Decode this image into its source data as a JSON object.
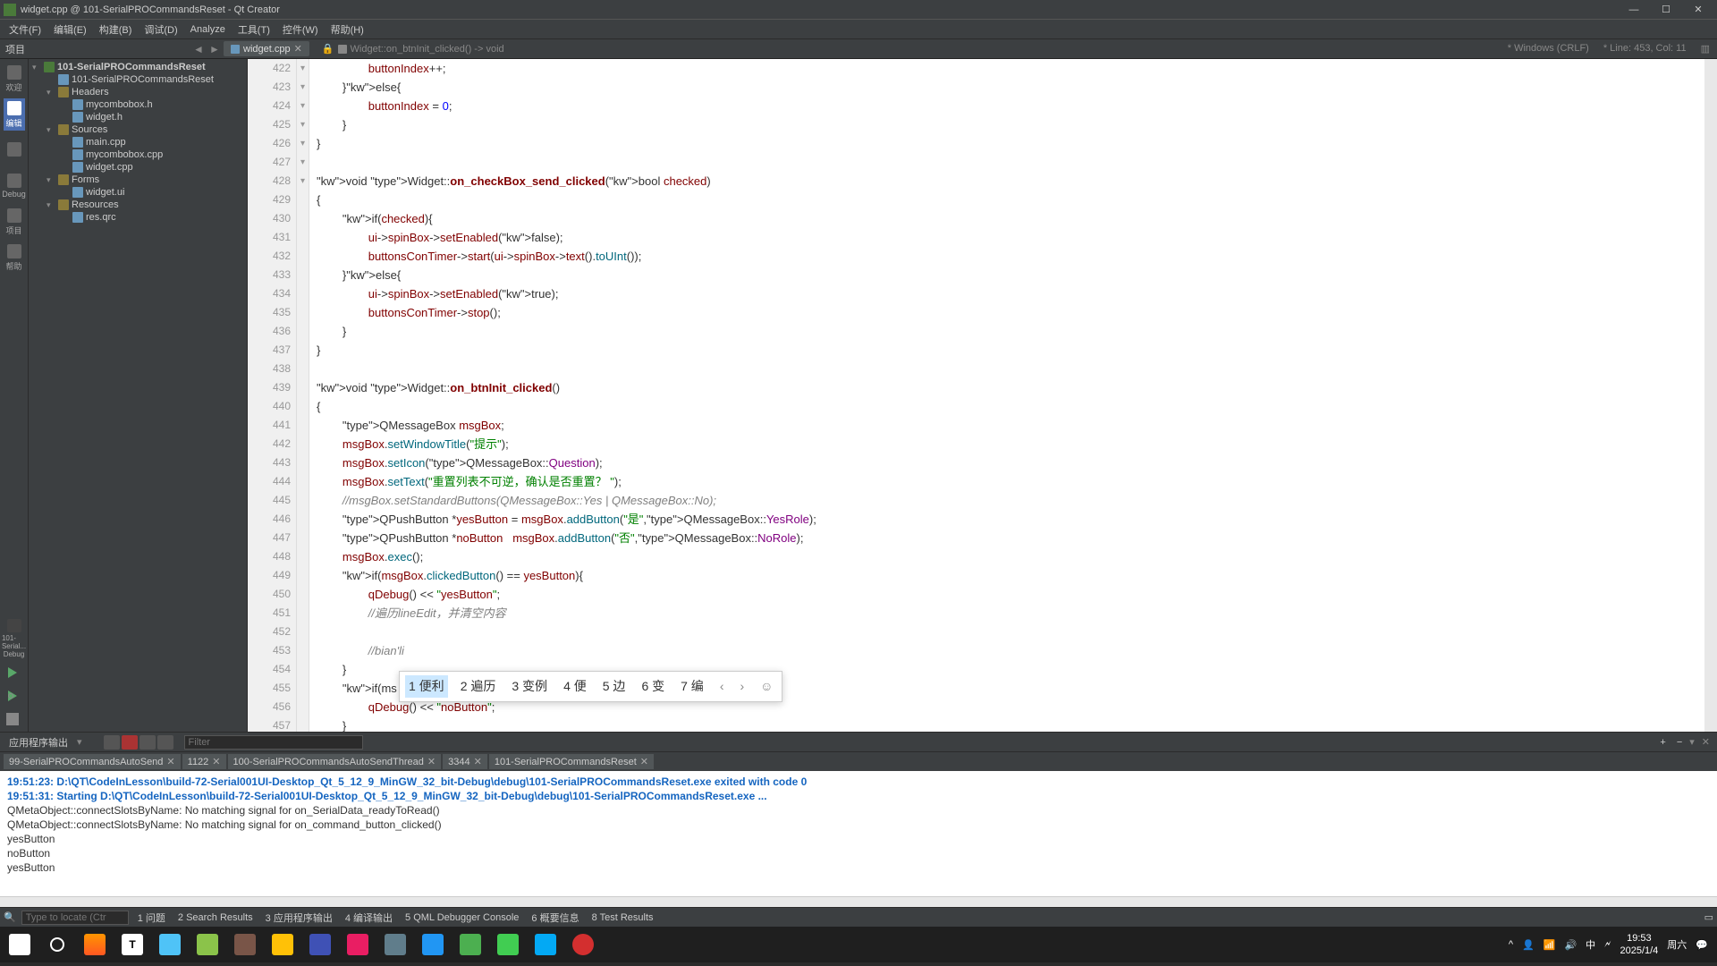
{
  "window": {
    "title": "widget.cpp @ 101-SerialPROCommandsReset - Qt Creator"
  },
  "menu": {
    "items": [
      "文件(F)",
      "编辑(E)",
      "构建(B)",
      "调试(D)",
      "Analyze",
      "工具(T)",
      "控件(W)",
      "帮助(H)"
    ]
  },
  "tabs": {
    "toolbar_label": "项目",
    "file_tab": "widget.cpp",
    "breadcrumb": "Widget::on_btnInit_clicked() -> void",
    "encoding": "* Windows (CRLF)",
    "position": "* Line: 453, Col: 11"
  },
  "sidebar": {
    "items": [
      {
        "label": "欢迎"
      },
      {
        "label": "编辑"
      },
      {
        "label": ""
      },
      {
        "label": "Debug"
      },
      {
        "label": "项目"
      },
      {
        "label": "帮助"
      }
    ],
    "bottom": {
      "project": "101-Serial...",
      "config": "Debug"
    }
  },
  "tree": {
    "root": "101-SerialPROCommandsReset",
    "pro": "101-SerialPROCommandsReset",
    "headers": "Headers",
    "headers_items": [
      "mycombobox.h",
      "widget.h"
    ],
    "sources": "Sources",
    "sources_items": [
      "main.cpp",
      "mycombobox.cpp",
      "widget.cpp"
    ],
    "forms": "Forms",
    "forms_items": [
      "widget.ui"
    ],
    "resources": "Resources",
    "resources_items": [
      "res.qrc"
    ]
  },
  "code": {
    "lines": [
      {
        "n": 422,
        "text": "                buttonIndex++;"
      },
      {
        "n": 423,
        "text": "        }else{"
      },
      {
        "n": 424,
        "text": "                buttonIndex = 0;"
      },
      {
        "n": 425,
        "text": "        }"
      },
      {
        "n": 426,
        "text": "}"
      },
      {
        "n": 427,
        "text": ""
      },
      {
        "n": 428,
        "text": "void Widget::on_checkBox_send_clicked(bool checked)"
      },
      {
        "n": 429,
        "text": "{"
      },
      {
        "n": 430,
        "text": "        if(checked){"
      },
      {
        "n": 431,
        "text": "                ui->spinBox->setEnabled(false);"
      },
      {
        "n": 432,
        "text": "                buttonsConTimer->start(ui->spinBox->text().toUInt());"
      },
      {
        "n": 433,
        "text": "        }else{"
      },
      {
        "n": 434,
        "text": "                ui->spinBox->setEnabled(true);"
      },
      {
        "n": 435,
        "text": "                buttonsConTimer->stop();"
      },
      {
        "n": 436,
        "text": "        }"
      },
      {
        "n": 437,
        "text": "}"
      },
      {
        "n": 438,
        "text": ""
      },
      {
        "n": 439,
        "text": "void Widget::on_btnInit_clicked()"
      },
      {
        "n": 440,
        "text": "{"
      },
      {
        "n": 441,
        "text": "        QMessageBox msgBox;"
      },
      {
        "n": 442,
        "text": "        msgBox.setWindowTitle(\"提示\");"
      },
      {
        "n": 443,
        "text": "        msgBox.setIcon(QMessageBox::Question);"
      },
      {
        "n": 444,
        "text": "        msgBox.setText(\"重置列表不可逆，确认是否重置？ \");"
      },
      {
        "n": 445,
        "text": "        //msgBox.setStandardButtons(QMessageBox::Yes | QMessageBox::No);"
      },
      {
        "n": 446,
        "text": "        QPushButton *yesButton = msgBox.addButton(\"是\",QMessageBox::YesRole);"
      },
      {
        "n": 447,
        "text": "        QPushButton *noButton   msgBox.addButton(\"否\",QMessageBox::NoRole);"
      },
      {
        "n": 448,
        "text": "        msgBox.exec();"
      },
      {
        "n": 449,
        "text": "        if(msgBox.clickedButton() == yesButton){"
      },
      {
        "n": 450,
        "text": "                qDebug() << \"yesButton\";"
      },
      {
        "n": 451,
        "text": "                //遍历lineEdit，并清空内容"
      },
      {
        "n": 452,
        "text": ""
      },
      {
        "n": 453,
        "text": "                //bian'li"
      },
      {
        "n": 454,
        "text": "        }"
      },
      {
        "n": 455,
        "text": "        if(ms"
      },
      {
        "n": 456,
        "text": "                qDebug() << \"noButton\";"
      },
      {
        "n": 457,
        "text": "        }"
      }
    ]
  },
  "ime": {
    "candidates": [
      "1 便利",
      "2 遍历",
      "3 变例",
      "4 便",
      "5 边",
      "6 变",
      "7 编"
    ]
  },
  "output_toolbar": {
    "title": "应用程序输出",
    "filter_placeholder": "Filter"
  },
  "output_tabs": [
    {
      "label": "99-SerialPROCommandsAutoSend"
    },
    {
      "label": "1122"
    },
    {
      "label": "100-SerialPROCommandsAutoSendThread"
    },
    {
      "label": "3344"
    },
    {
      "label": "101-SerialPROCommandsReset"
    }
  ],
  "output": {
    "lines": [
      "19:51:23: D:\\QT\\CodeInLesson\\build-72-Serial001UI-Desktop_Qt_5_12_9_MinGW_32_bit-Debug\\debug\\101-SerialPROCommandsReset.exe exited with code 0",
      "",
      "19:51:31: Starting D:\\QT\\CodeInLesson\\build-72-Serial001UI-Desktop_Qt_5_12_9_MinGW_32_bit-Debug\\debug\\101-SerialPROCommandsReset.exe ...",
      "QMetaObject::connectSlotsByName: No matching signal for on_SerialData_readyToRead()",
      "QMetaObject::connectSlotsByName: No matching signal for on_command_button_clicked()",
      "yesButton",
      "noButton",
      "yesButton"
    ]
  },
  "statusbar": {
    "search_placeholder": "Type to locate (Ctr",
    "items": [
      "1 问题",
      "2 Search Results",
      "3 应用程序输出",
      "4 编译输出",
      "5 QML Debugger Console",
      "6 概要信息",
      "8 Test Results"
    ]
  },
  "taskbar": {
    "time": "19:53",
    "date": "2025/1/4",
    "weekday": "周六"
  }
}
